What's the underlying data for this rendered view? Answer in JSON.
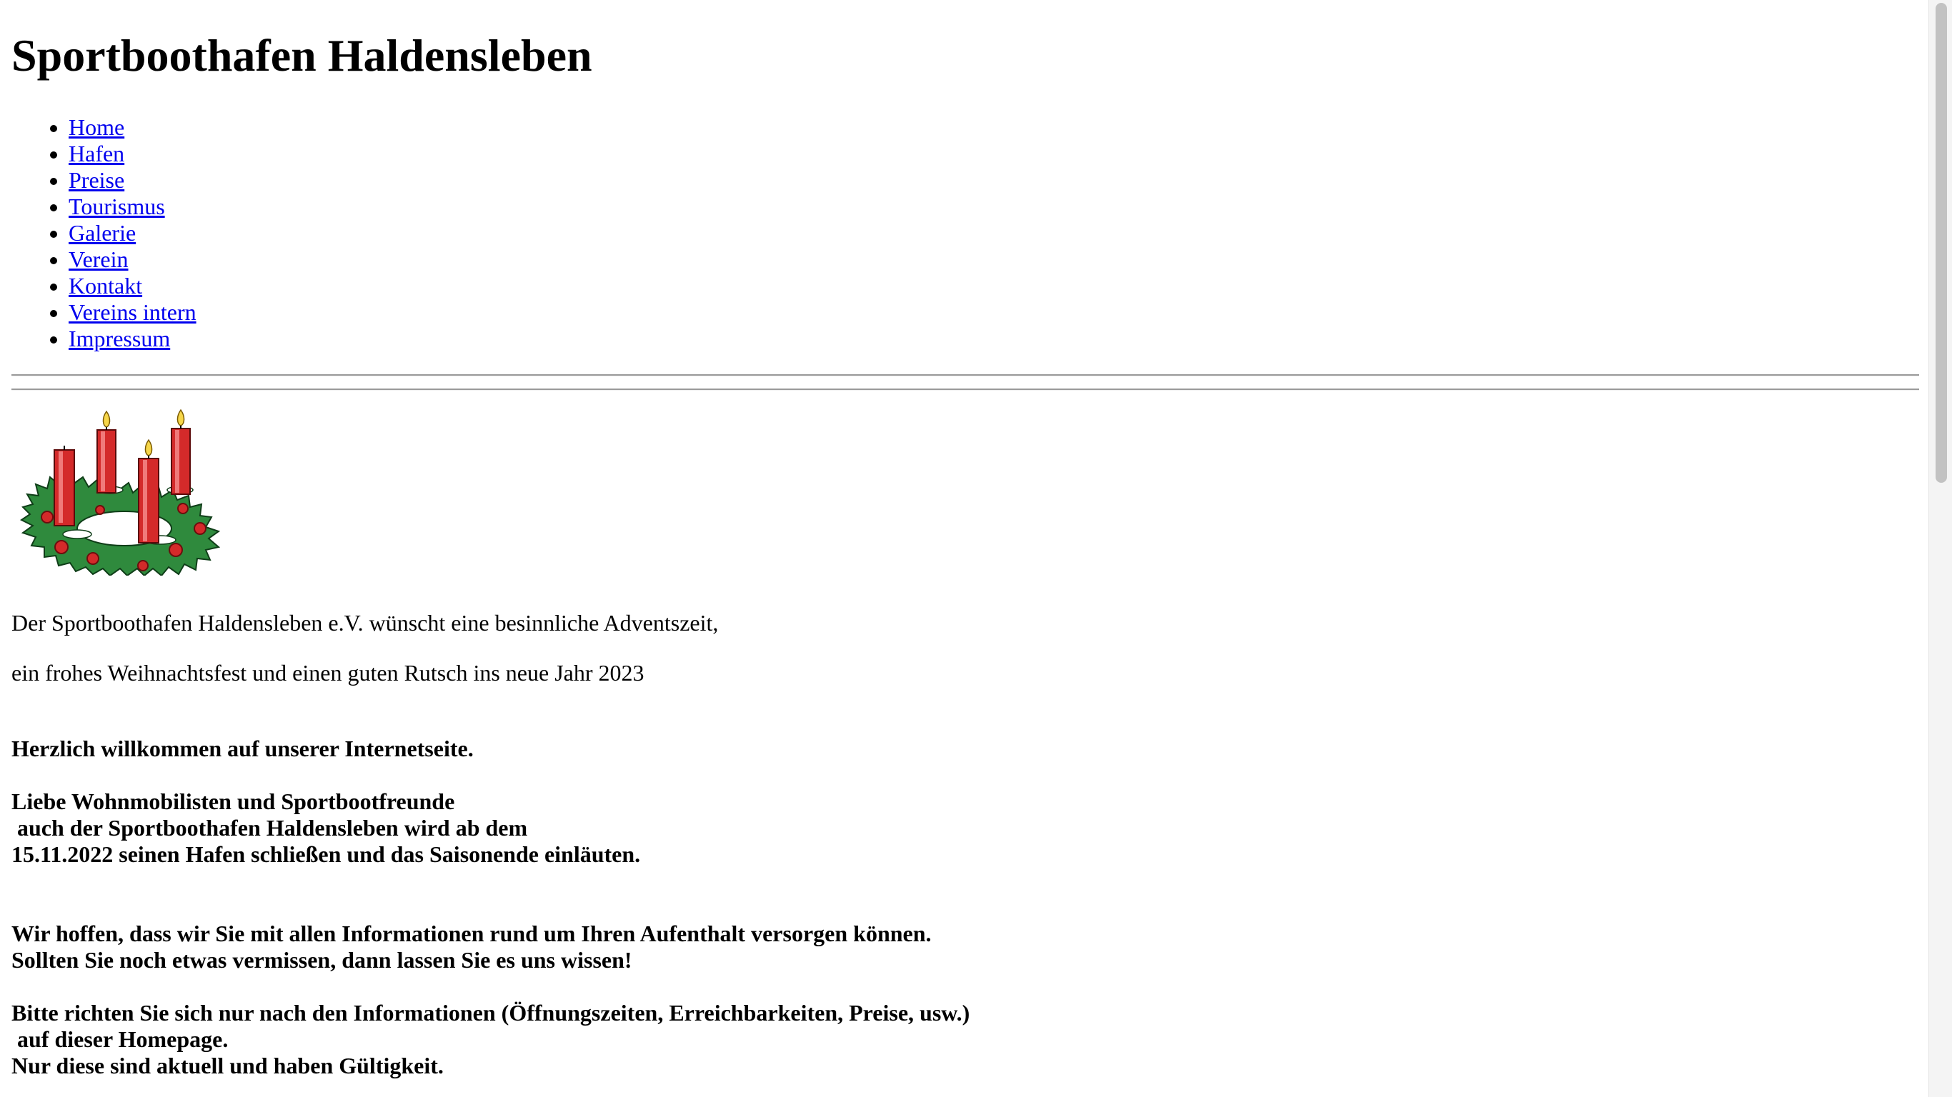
{
  "header": {
    "title": "Sportboothafen Haldensleben"
  },
  "nav": {
    "items": [
      {
        "label": "Home"
      },
      {
        "label": "Hafen"
      },
      {
        "label": "Preise"
      },
      {
        "label": "Tourismus"
      },
      {
        "label": "Galerie"
      },
      {
        "label": "Verein"
      },
      {
        "label": "Kontakt"
      },
      {
        "label": "Vereins intern"
      },
      {
        "label": "Impressum"
      }
    ]
  },
  "main": {
    "greeting_line1": "Der Sportboothafen Haldensleben e.V. wünscht eine besinnliche Adventszeit,",
    "greeting_line2": "ein frohes Weihnachtsfest und einen guten Rutsch ins neue Jahr 2023",
    "welcome": "Herzlich willkommen auf unserer Internetseite.",
    "notice_line1": "Liebe Wohnmobilisten und Sportbootfreunde",
    "notice_line2": " auch der Sportboothafen Haldensleben wird ab dem",
    "notice_line3": "15.11.2022 seinen Hafen schließen und das Saisonende einläuten.",
    "info_line1": "Wir hoffen, dass wir Sie mit allen Informationen rund um Ihren Aufenthalt versorgen können.",
    "info_line2": "Sollten Sie noch etwas vermissen, dann lassen Sie es uns wissen!",
    "hint_line1": "Bitte richten Sie sich nur nach den Informationen (Öffnungszeiten, Erreichbarkeiten, Preise, usw.)",
    "hint_line2": " auf dieser Homepage.",
    "hint_line3": "Nur diese sind aktuell und haben Gültigkeit."
  },
  "image": {
    "name": "advent-wreath"
  },
  "colors": {
    "link": "#0000ee",
    "text": "#000000",
    "candle": "#d42a2a",
    "wreath": "#2e8b3e"
  }
}
